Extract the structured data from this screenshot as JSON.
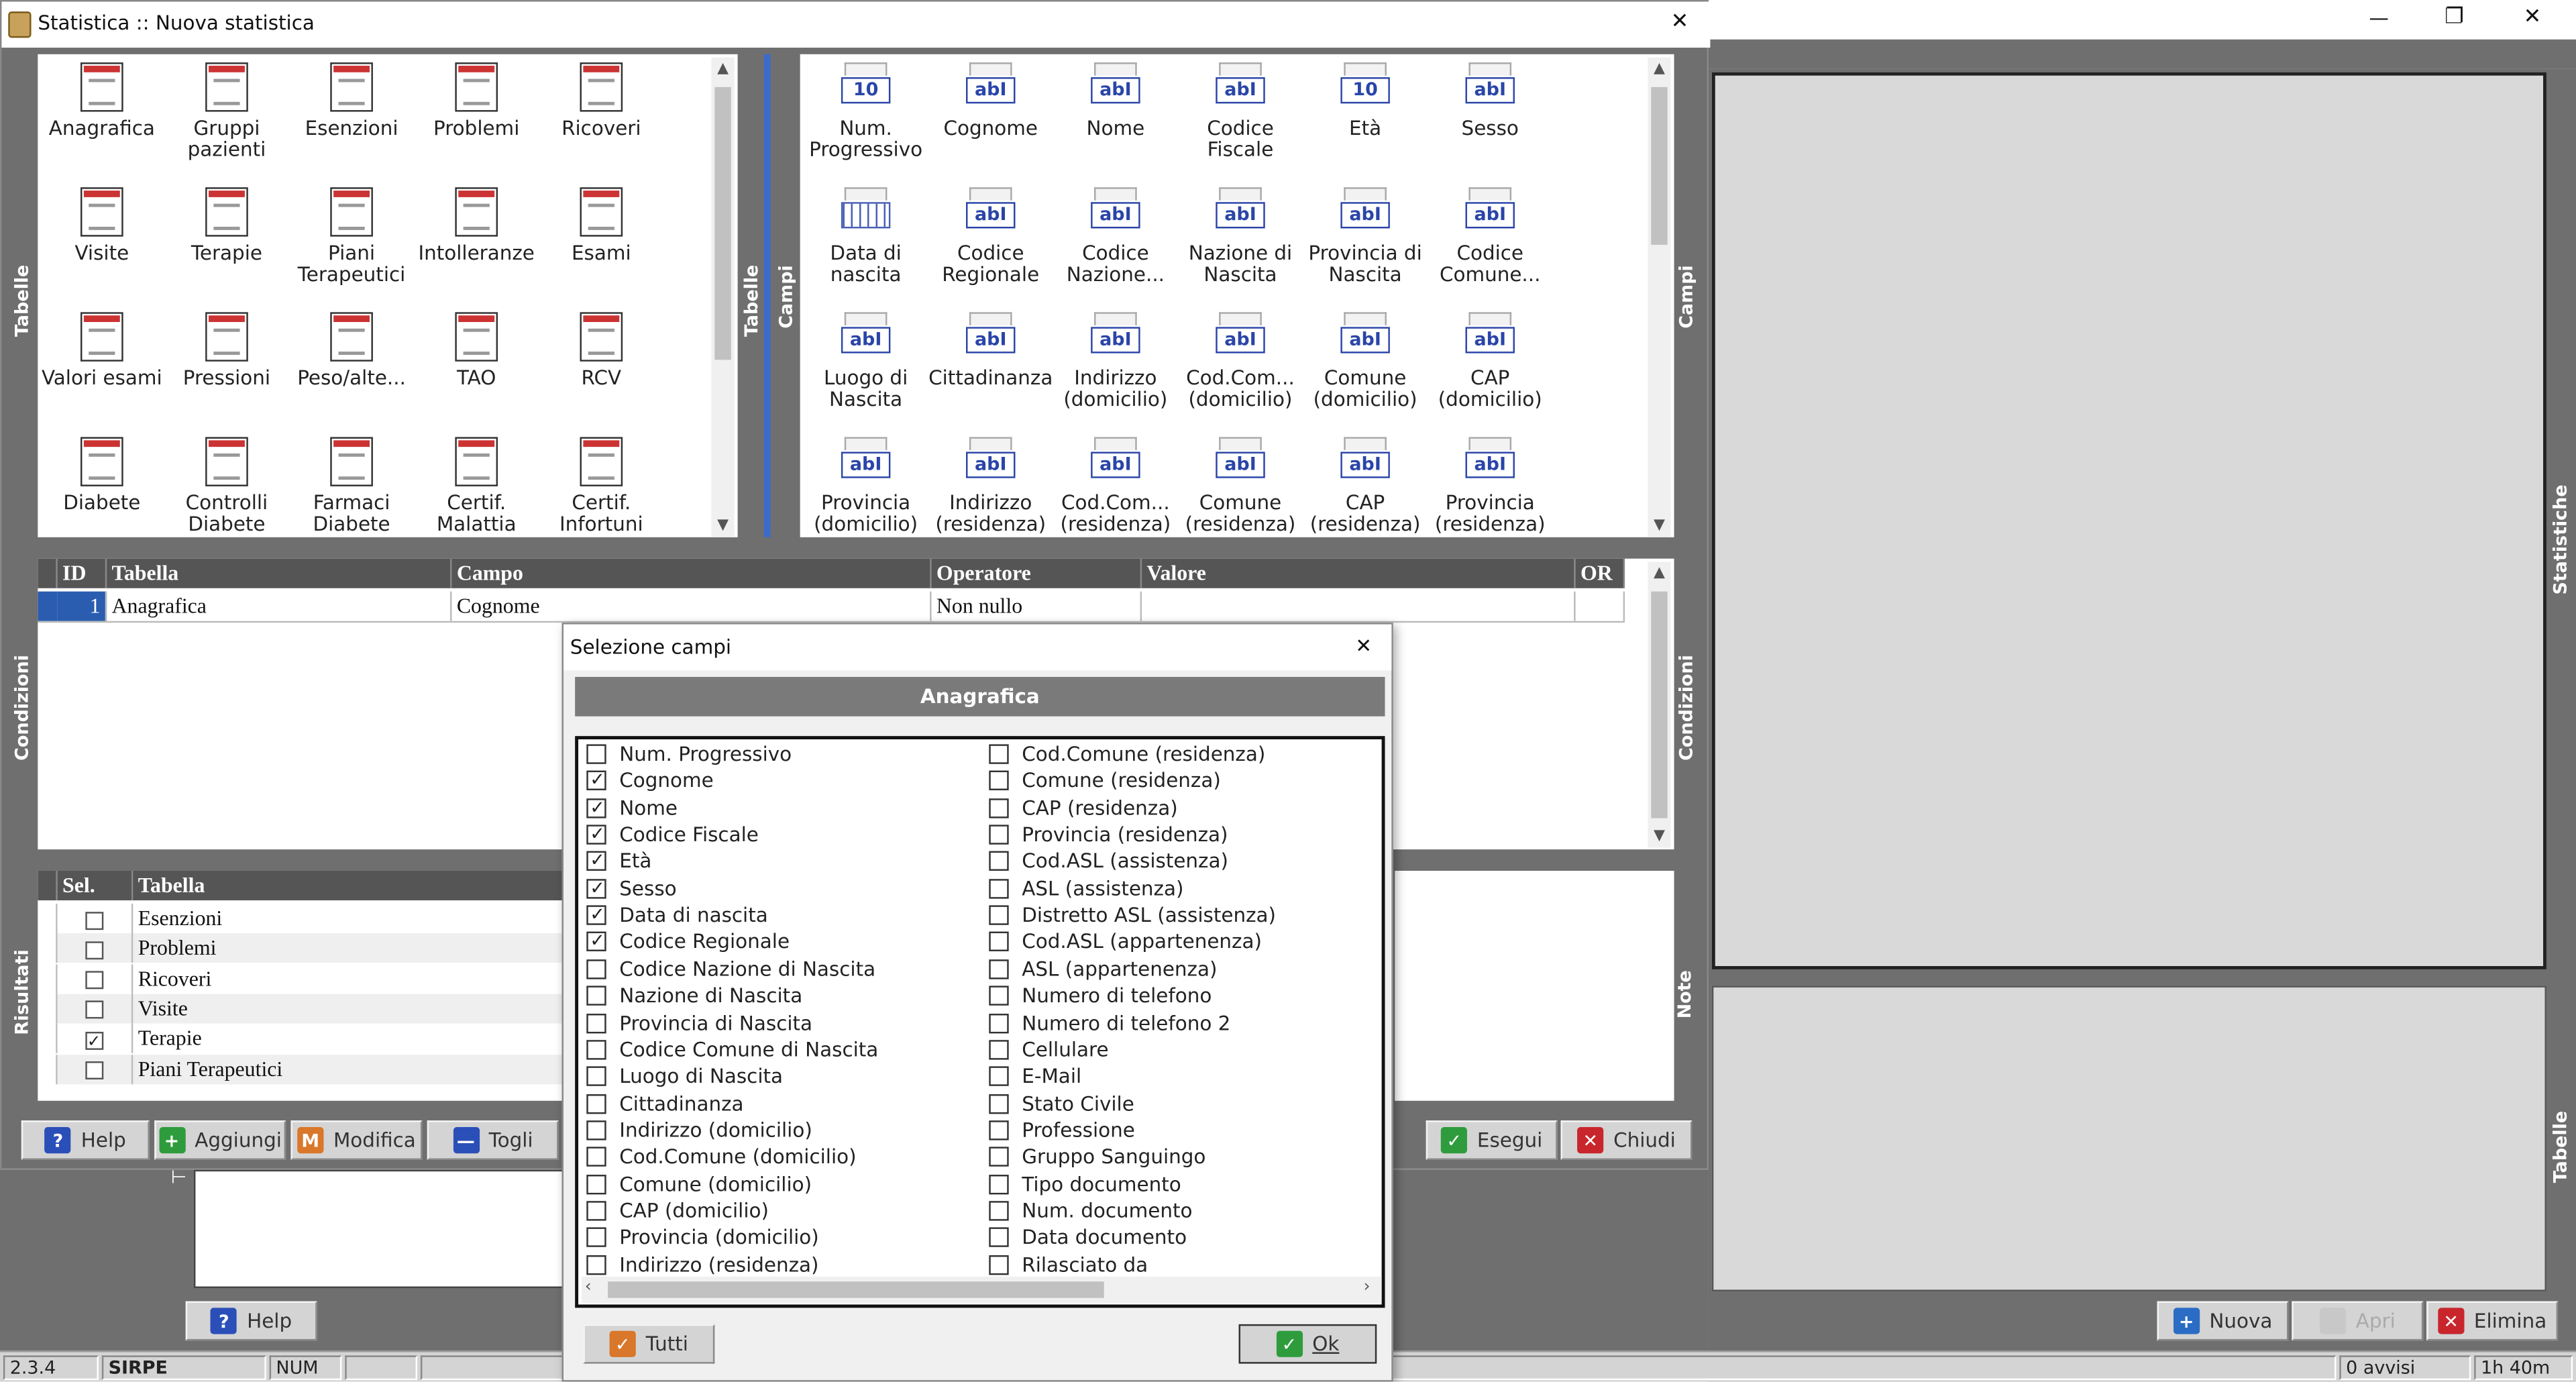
{
  "bg_window": {
    "controls": {
      "minimize": "—",
      "restore": "❐",
      "close": "✕"
    },
    "side_labels": {
      "statistiche": "Statistiche",
      "tabelle": "Tabelle"
    },
    "bottom_buttons": {
      "help": "Help",
      "nuova": "Nuova",
      "apri": "Apri",
      "elimina": "Elimina"
    },
    "memo_marker": "⊢"
  },
  "status_bar": {
    "version": "2.3.4",
    "app": "SIRPE",
    "num": "NUM",
    "warnings": "0 avvisi",
    "time": "1h 40m"
  },
  "main_window": {
    "title": "Statistica :: Nuova statistica",
    "close": "✕",
    "side_labels": {
      "tabelle_left": "Tabelle",
      "tabelle_mid": "Tabelle",
      "campi_mid": "Campi",
      "campi_right": "Campi",
      "condizioni_left": "Condizioni",
      "condizioni_right": "Condizioni",
      "risultati": "Risultati",
      "note": "Note"
    },
    "tables": [
      {
        "label": "Anagrafica"
      },
      {
        "label": "Gruppi pazienti"
      },
      {
        "label": "Esenzioni"
      },
      {
        "label": "Problemi"
      },
      {
        "label": "Ricoveri"
      },
      {
        "label": "Visite"
      },
      {
        "label": "Terapie"
      },
      {
        "label": "Piani Terapeutici"
      },
      {
        "label": "Intolleranze"
      },
      {
        "label": "Esami"
      },
      {
        "label": "Valori esami"
      },
      {
        "label": "Pressioni"
      },
      {
        "label": "Peso/alte..."
      },
      {
        "label": "TAO"
      },
      {
        "label": "RCV"
      },
      {
        "label": "Diabete"
      },
      {
        "label": "Controlli Diabete"
      },
      {
        "label": "Farmaci Diabete"
      },
      {
        "label": "Certif. Malattia"
      },
      {
        "label": "Certif. Infortuni"
      }
    ],
    "fields": [
      {
        "label": "Num. Progressivo",
        "icon": "10"
      },
      {
        "label": "Cognome",
        "icon": "abI"
      },
      {
        "label": "Nome",
        "icon": "abI"
      },
      {
        "label": "Codice Fiscale",
        "icon": "abI"
      },
      {
        "label": "Età",
        "icon": "10"
      },
      {
        "label": "Sesso",
        "icon": "abI"
      },
      {
        "label": "Data di nascita",
        "icon": "cal"
      },
      {
        "label": "Codice Regionale",
        "icon": "abI"
      },
      {
        "label": "Codice Nazione...",
        "icon": "abI"
      },
      {
        "label": "Nazione di Nascita",
        "icon": "abI"
      },
      {
        "label": "Provincia di Nascita",
        "icon": "abI"
      },
      {
        "label": "Codice Comune...",
        "icon": "abI"
      },
      {
        "label": "Luogo di Nascita",
        "icon": "abI"
      },
      {
        "label": "Cittadinanza",
        "icon": "abI"
      },
      {
        "label": "Indirizzo (domicilio)",
        "icon": "abI"
      },
      {
        "label": "Cod.Com... (domicilio)",
        "icon": "abI"
      },
      {
        "label": "Comune (domicilio)",
        "icon": "abI"
      },
      {
        "label": "CAP (domicilio)",
        "icon": "abI"
      },
      {
        "label": "Provincia (domicilio)",
        "icon": "abI"
      },
      {
        "label": "Indirizzo (residenza)",
        "icon": "abI"
      },
      {
        "label": "Cod.Com... (residenza)",
        "icon": "abI"
      },
      {
        "label": "Comune (residenza)",
        "icon": "abI"
      },
      {
        "label": "CAP (residenza)",
        "icon": "abI"
      },
      {
        "label": "Provincia (residenza)",
        "icon": "abI"
      }
    ],
    "conditions": {
      "headers": {
        "id": "ID",
        "tabella": "Tabella",
        "campo": "Campo",
        "operatore": "Operatore",
        "valore": "Valore",
        "or": "OR"
      },
      "rows": [
        {
          "id": "1",
          "tabella": "Anagrafica",
          "campo": "Cognome",
          "operatore": "Non nullo",
          "valore": "",
          "or": ""
        }
      ]
    },
    "results": {
      "headers": {
        "sel": "Sel.",
        "tabella": "Tabella"
      },
      "rows": [
        {
          "label": "Esenzioni",
          "checked": false
        },
        {
          "label": "Problemi",
          "checked": false
        },
        {
          "label": "Ricoveri",
          "checked": false
        },
        {
          "label": "Visite",
          "checked": false
        },
        {
          "label": "Terapie",
          "checked": true
        },
        {
          "label": "Piani Terapeutici",
          "checked": false
        }
      ]
    },
    "buttons": {
      "help": "Help",
      "aggiungi": "Aggiungi",
      "modifica": "Modifica",
      "togli": "Togli",
      "esegui": "Esegui",
      "chiudi": "Chiudi"
    }
  },
  "dialog": {
    "title": "Selezione campi",
    "close": "✕",
    "header": "Anagrafica",
    "left_items": [
      {
        "label": "Num. Progressivo",
        "checked": false
      },
      {
        "label": "Cognome",
        "checked": true
      },
      {
        "label": "Nome",
        "checked": true
      },
      {
        "label": "Codice Fiscale",
        "checked": true
      },
      {
        "label": "Età",
        "checked": true
      },
      {
        "label": "Sesso",
        "checked": true
      },
      {
        "label": "Data di nascita",
        "checked": true
      },
      {
        "label": "Codice Regionale",
        "checked": true
      },
      {
        "label": "Codice Nazione di Nascita",
        "checked": false
      },
      {
        "label": "Nazione di Nascita",
        "checked": false
      },
      {
        "label": "Provincia di Nascita",
        "checked": false
      },
      {
        "label": "Codice Comune di Nascita",
        "checked": false
      },
      {
        "label": "Luogo di Nascita",
        "checked": false
      },
      {
        "label": "Cittadinanza",
        "checked": false
      },
      {
        "label": "Indirizzo (domicilio)",
        "checked": false
      },
      {
        "label": "Cod.Comune (domicilio)",
        "checked": false
      },
      {
        "label": "Comune (domicilio)",
        "checked": false
      },
      {
        "label": "CAP (domicilio)",
        "checked": false
      },
      {
        "label": "Provincia (domicilio)",
        "checked": false
      },
      {
        "label": "Indirizzo (residenza)",
        "checked": false
      }
    ],
    "right_items": [
      {
        "label": "Cod.Comune (residenza)",
        "checked": false
      },
      {
        "label": "Comune (residenza)",
        "checked": false
      },
      {
        "label": "CAP (residenza)",
        "checked": false
      },
      {
        "label": "Provincia (residenza)",
        "checked": false
      },
      {
        "label": "Cod.ASL (assistenza)",
        "checked": false
      },
      {
        "label": "ASL (assistenza)",
        "checked": false
      },
      {
        "label": "Distretto ASL (assistenza)",
        "checked": false
      },
      {
        "label": "Cod.ASL (appartenenza)",
        "checked": false
      },
      {
        "label": "ASL (appartenenza)",
        "checked": false
      },
      {
        "label": "Numero di telefono",
        "checked": false
      },
      {
        "label": "Numero di telefono 2",
        "checked": false
      },
      {
        "label": "Cellulare",
        "checked": false
      },
      {
        "label": "E-Mail",
        "checked": false
      },
      {
        "label": "Stato Civile",
        "checked": false
      },
      {
        "label": "Professione",
        "checked": false
      },
      {
        "label": "Gruppo Sanguingo",
        "checked": false
      },
      {
        "label": "Tipo documento",
        "checked": false
      },
      {
        "label": "Num. documento",
        "checked": false
      },
      {
        "label": "Data documento",
        "checked": false
      },
      {
        "label": "Rilasciato da",
        "checked": false
      }
    ],
    "buttons": {
      "tutti": "Tutti",
      "ok": "Ok"
    }
  }
}
